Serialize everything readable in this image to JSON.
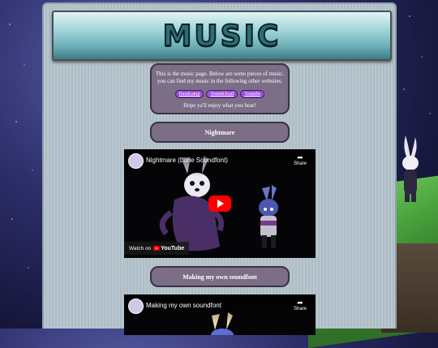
{
  "page": {
    "title": "MUSIC"
  },
  "intro": {
    "line1": "This is the music page. Below are some pieces of music.",
    "line2": "you can find my music in the following other websites.",
    "links": [
      "Bandcamp",
      "Soundcloud",
      "Youtube"
    ],
    "closing": "Hope ya'll enjoy what you hear!"
  },
  "tracks": [
    {
      "title": "Nightmare",
      "video_title": "Nightmare (Lune Soundfont)",
      "share_label": "Share",
      "watch_on": "Watch on",
      "brand": "YouTube"
    },
    {
      "title": "Making my own soundfont",
      "video_title": "Making my own soundfont",
      "share_label": "Share"
    }
  ],
  "colors": {
    "card": "#7b6e86",
    "link_pill": "#a14ee0",
    "play_button": "#ff0000"
  }
}
